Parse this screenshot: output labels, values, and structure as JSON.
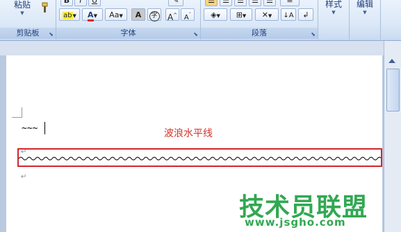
{
  "ribbon": {
    "clipboard": {
      "paste_label": "粘贴",
      "group_label": "剪贴板"
    },
    "font": {
      "group_label": "字体",
      "aa_label": "Aa",
      "a_label": "A"
    },
    "paragraph": {
      "group_label": "段落"
    },
    "styles": {
      "label": "样式"
    },
    "editing": {
      "label": "编辑"
    }
  },
  "document": {
    "typed_text": "~~~",
    "title": "波浪水平线",
    "paragraph_mark": "↵"
  },
  "watermark": {
    "text": "技术员联盟",
    "url": "www.jsgho.com"
  },
  "colors": {
    "title_red": "#d0332a",
    "highlight_box": "#d2262b",
    "watermark_green": "#32a852"
  }
}
